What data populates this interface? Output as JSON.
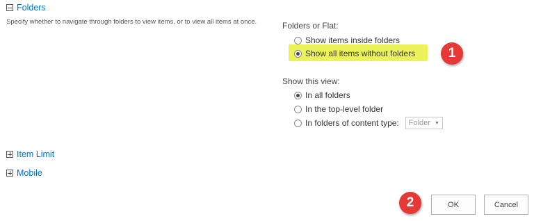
{
  "sections": {
    "folders": {
      "title": "Folders",
      "description": "Specify whether to navigate through folders to view items, or to view all items at once."
    },
    "item_limit": {
      "title": "Item Limit"
    },
    "mobile": {
      "title": "Mobile"
    }
  },
  "folders_or_flat": {
    "label": "Folders or Flat:",
    "options": [
      {
        "label": "Show items inside folders",
        "checked": false
      },
      {
        "label": "Show all items without folders",
        "checked": true
      }
    ]
  },
  "show_this_view": {
    "label": "Show this view:",
    "options": [
      {
        "label": "In all folders",
        "checked": true
      },
      {
        "label": "In the top-level folder",
        "checked": false
      },
      {
        "label": "In folders of content type:",
        "checked": false
      }
    ],
    "content_type_select": {
      "value": "Folder",
      "arrow": "▼"
    }
  },
  "callouts": {
    "first": "1",
    "second": "2"
  },
  "buttons": {
    "ok": "OK",
    "cancel": "Cancel"
  },
  "colors": {
    "link": "#0072c6",
    "highlight": "#ecf35a",
    "badge": "#e53935"
  },
  "icons": {
    "collapse": "minus-box-icon",
    "expand": "plus-box-icon"
  }
}
